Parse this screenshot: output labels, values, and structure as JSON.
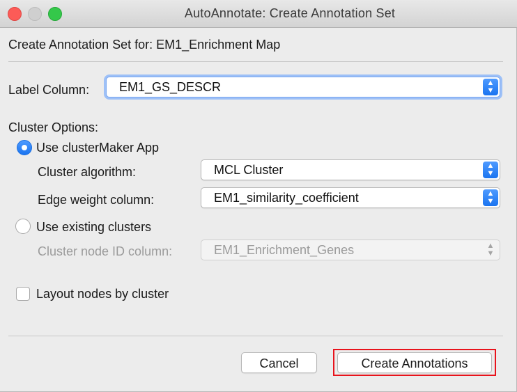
{
  "window": {
    "title": "AutoAnnotate: Create Annotation Set"
  },
  "heading": "Create Annotation Set for: EM1_Enrichment Map",
  "label_column": {
    "label": "Label Column:",
    "value": "EM1_GS_DESCR"
  },
  "cluster_options": {
    "label": "Cluster Options:",
    "use_clustermaker": {
      "label": "Use clusterMaker App",
      "selected": true,
      "algorithm_label": "Cluster algorithm:",
      "algorithm_value": "MCL Cluster",
      "edge_weight_label": "Edge weight column:",
      "edge_weight_value": "EM1_similarity_coefficient"
    },
    "use_existing": {
      "label": "Use existing clusters",
      "selected": false,
      "node_id_label": "Cluster node ID column:",
      "node_id_value": "EM1_Enrichment_Genes"
    }
  },
  "layout_nodes": {
    "label": "Layout nodes by cluster",
    "checked": false
  },
  "buttons": {
    "cancel": "Cancel",
    "create": "Create Annotations"
  },
  "colors": {
    "accent": "#1a74f0",
    "highlight": "#e8131c",
    "close": "#fc5b57",
    "maximize": "#34c84a"
  }
}
